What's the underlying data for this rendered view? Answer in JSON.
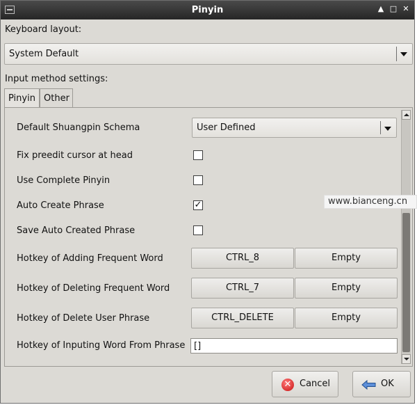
{
  "window": {
    "title": "Pinyin"
  },
  "keyboard_layout": {
    "label": "Keyboard layout:",
    "selected": "System Default"
  },
  "input_method": {
    "label": "Input method settings:"
  },
  "tabs": [
    {
      "label": "Pinyin",
      "active": true
    },
    {
      "label": "Other",
      "active": false
    }
  ],
  "settings": {
    "shuangpin": {
      "label": "Default Shuangpin Schema",
      "selected": "User Defined"
    },
    "fix_preedit": {
      "label": "Fix preedit cursor at head",
      "checked": false
    },
    "complete_pinyin": {
      "label": "Use Complete Pinyin",
      "checked": false
    },
    "auto_create": {
      "label": "Auto Create Phrase",
      "checked": true
    },
    "save_auto": {
      "label": "Save Auto Created Phrase",
      "checked": false
    },
    "hotkey_add": {
      "label": "Hotkey of Adding Frequent Word",
      "key": "CTRL_8",
      "alt": "Empty"
    },
    "hotkey_delete": {
      "label": "Hotkey of Deleting Frequent Word",
      "key": "CTRL_7",
      "alt": "Empty"
    },
    "hotkey_delete_user": {
      "label": "Hotkey of Delete User Phrase",
      "key": "CTRL_DELETE",
      "alt": "Empty"
    },
    "hotkey_inputing": {
      "label": "Hotkey of Inputing Word From Phrase",
      "value": "[]"
    }
  },
  "buttons": {
    "cancel": "Cancel",
    "ok": "OK"
  },
  "watermark": "www.bianceng.cn",
  "colors": {
    "titlebar": "#2f2f2f",
    "window_bg": "#dcdad5",
    "cancel_icon": "#d01818",
    "ok_icon": "#3a6fc4"
  }
}
